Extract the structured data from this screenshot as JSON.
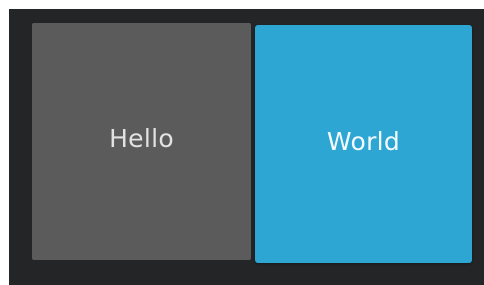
{
  "tiles": [
    {
      "label": "Hello",
      "background": "#5b5b5b",
      "text_color": "#e2e2e2"
    },
    {
      "label": "World",
      "background": "#2ea6d4",
      "text_color": "#f2fafd"
    }
  ],
  "colors": {
    "canvas": "#242526",
    "page": "#ffffff"
  }
}
